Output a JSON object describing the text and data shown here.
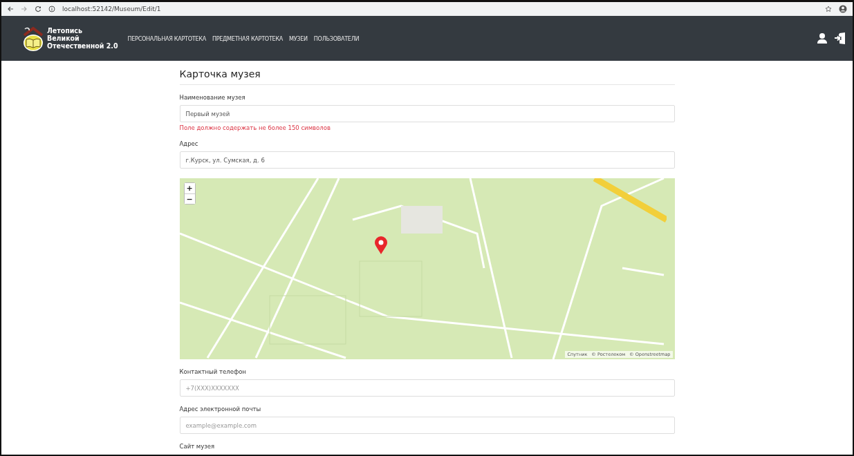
{
  "browser": {
    "url": "localhost:52142/Museum/Edit/1"
  },
  "navbar": {
    "brand_lines": [
      "Летопись",
      "Великой",
      "Отечественной 2.0"
    ],
    "links": [
      {
        "label": "ПЕРСОНАЛЬНАЯ КАРТОТЕКА"
      },
      {
        "label": "ПРЕДМЕТНАЯ КАРТОТЕКА"
      },
      {
        "label": "МУЗЕИ"
      },
      {
        "label": "ПОЛЬЗОВАТЕЛИ"
      }
    ]
  },
  "page": {
    "title": "Карточка музея"
  },
  "form": {
    "items": [
      {
        "kind": "field",
        "label": "Наименование музея",
        "value": "Первый музей",
        "error": "Поле должно содержать не более 150 символов"
      },
      {
        "kind": "field",
        "label": "Адрес",
        "value": "г.Курск, ул. Сумская, д. 6"
      },
      {
        "kind": "map",
        "zoom_in": "+",
        "zoom_out": "−",
        "attribution": [
          "Спутник",
          "© Ростелеком",
          "© Openstreetmap"
        ]
      },
      {
        "kind": "field",
        "label": "Контактный телефон",
        "placeholder": "+7(XXX)XXXXXXX"
      },
      {
        "kind": "field",
        "label": "Адрес электронной почты",
        "placeholder": "example@example.com"
      },
      {
        "kind": "label",
        "label": "Сайт музея"
      }
    ]
  }
}
